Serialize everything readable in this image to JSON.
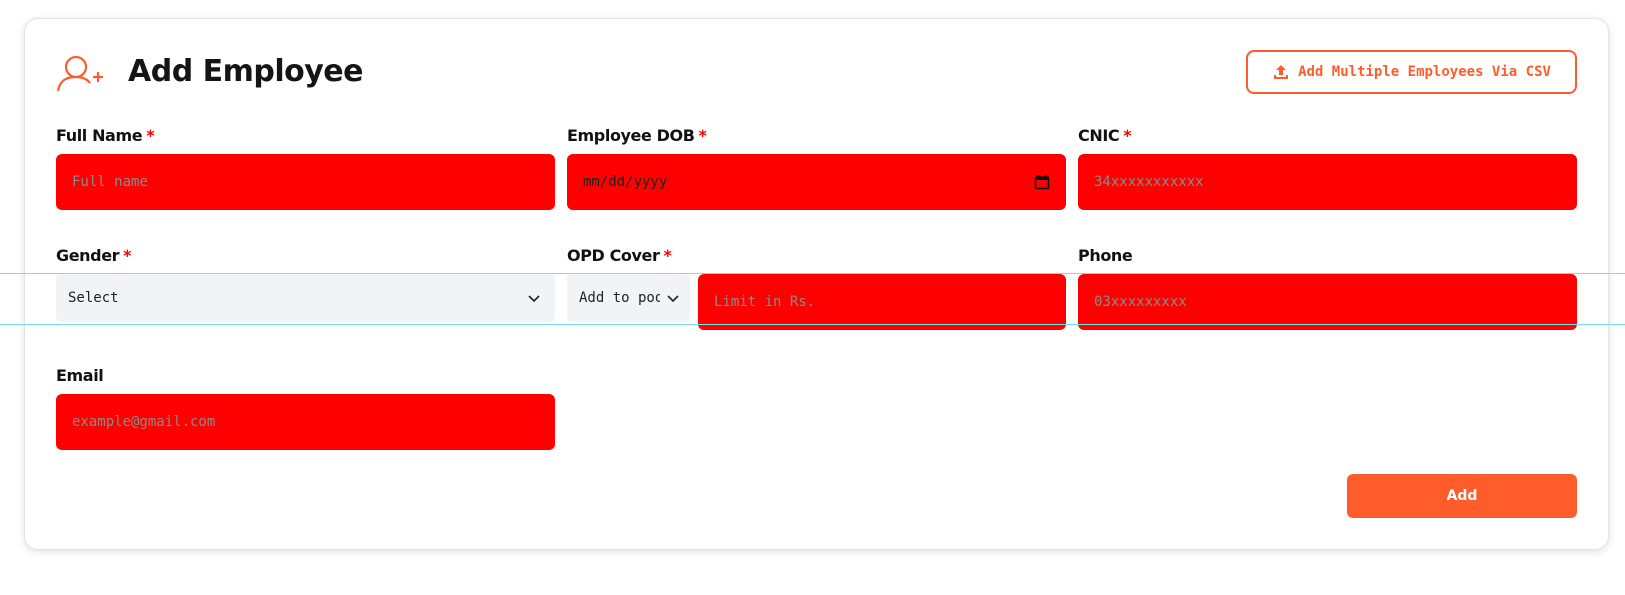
{
  "header": {
    "title": "Add Employee",
    "icon": "add-user-icon",
    "csv_button_label": "Add Multiple Employees Via CSV",
    "csv_button_icon": "upload-icon"
  },
  "form": {
    "full_name": {
      "label": "Full Name",
      "required": "*",
      "placeholder": "Full name"
    },
    "dob": {
      "label": "Employee DOB",
      "required": "*",
      "placeholder": "mm/dd/yyyy",
      "icon": "calendar-icon"
    },
    "cnic": {
      "label": "CNIC",
      "required": "*",
      "placeholder": "34xxxxxxxxxxx"
    },
    "gender": {
      "label": "Gender",
      "required": "*",
      "selected": "Select"
    },
    "opd_cover": {
      "label": "OPD Cover",
      "required": "*",
      "selected": "Add to pool",
      "limit_placeholder": "Limit in Rs."
    },
    "phone": {
      "label": "Phone",
      "placeholder": "03xxxxxxxxx"
    },
    "email": {
      "label": "Email",
      "placeholder": "example@gmail.com"
    }
  },
  "actions": {
    "add_label": "Add"
  },
  "colors": {
    "accent": "#ff5c2b",
    "input_fill": "#ff0000",
    "select_fill": "#f0f4f6",
    "required": "#ff0000",
    "guide": "#6fe6e6"
  }
}
